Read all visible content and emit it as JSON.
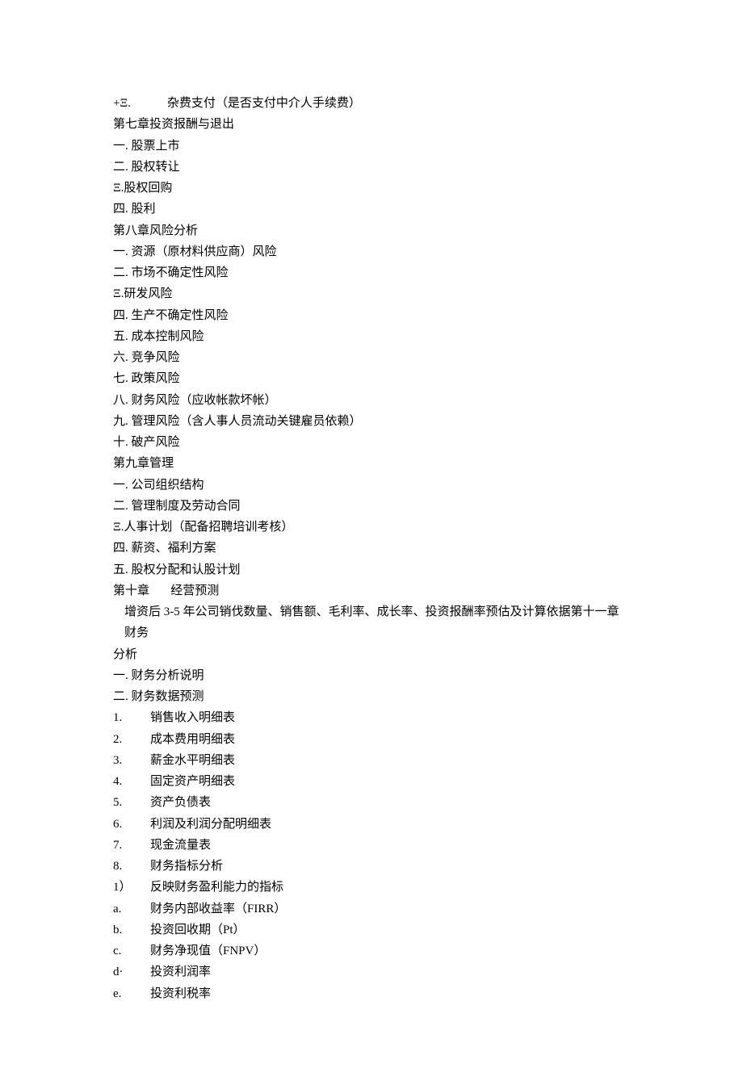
{
  "lines": {
    "l0_pre": "+Ξ.            ",
    "l0_text": "杂费支付（是否支付中介人手续费）",
    "l1": "第七章投资报酬与退出",
    "l2": "一. 股票上市",
    "l3": "二. 股权转让",
    "l4": "Ξ.股权回购",
    "l5": "四. 股利",
    "l6": "第八章风险分析",
    "l7": "一. 资源（原材料供应商）风险",
    "l8": "二. 市场不确定性风险",
    "l9": "Ξ.研发风险",
    "l10": "四. 生产不确定性风险",
    "l11": "五. 成本控制风险",
    "l12": "六. 竞争风险",
    "l13": "七. 政策风险",
    "l14": "八. 财务风险（应收帐款坏帐）",
    "l15": "九. 管理风险（含人事人员流动关键雇员依赖）",
    "l16": "十. 破产风险",
    "l17": "第九章管理",
    "l18": "一. 公司组织结构",
    "l19": "二. 管理制度及劳动合同",
    "l20": "Ξ.人事计划（配备招聘培训考核）",
    "l21": "四. 薪资、福利方案",
    "l22": "五. 股权分配和认股计划",
    "l23": "第十章       经营预测",
    "l24": "增资后 3-5 年公司销伐数量、销售额、毛利率、成长率、投资报酬率预估及计算依据第十一章财务",
    "l25": "分析",
    "l26": "一. 财务分析说明",
    "l27": "二. 财务数据预测",
    "n1_pre": "1.",
    "n1_text": "销售收入明细表",
    "n2_pre": "2.",
    "n2_text": "成本费用明细表",
    "n3_pre": "3.",
    "n3_text": "薪金水平明细表",
    "n4_pre": "4.",
    "n4_text": "固定资产明细表",
    "n5_pre": "5.",
    "n5_text": "资产负债表",
    "n6_pre": "6.",
    "n6_text": "利润及利润分配明细表",
    "n7_pre": "7.",
    "n7_text": "现金流量表",
    "n8_pre": "8.",
    "n8_text": "财务指标分析",
    "n9_pre": "1）",
    "n9_text": "反映财务盈利能力的指标",
    "n10_pre": "a.",
    "n10_text": "财务内部收益率（FIRR）",
    "n11_pre": "b.",
    "n11_text": "投资回收期（Pt）",
    "n12_pre": "c.",
    "n12_text": "财务净现值（FNPV）",
    "n13_pre": "d·",
    "n13_text": "投资利润率",
    "n14_pre": "e.",
    "n14_text": "投资利税率"
  }
}
